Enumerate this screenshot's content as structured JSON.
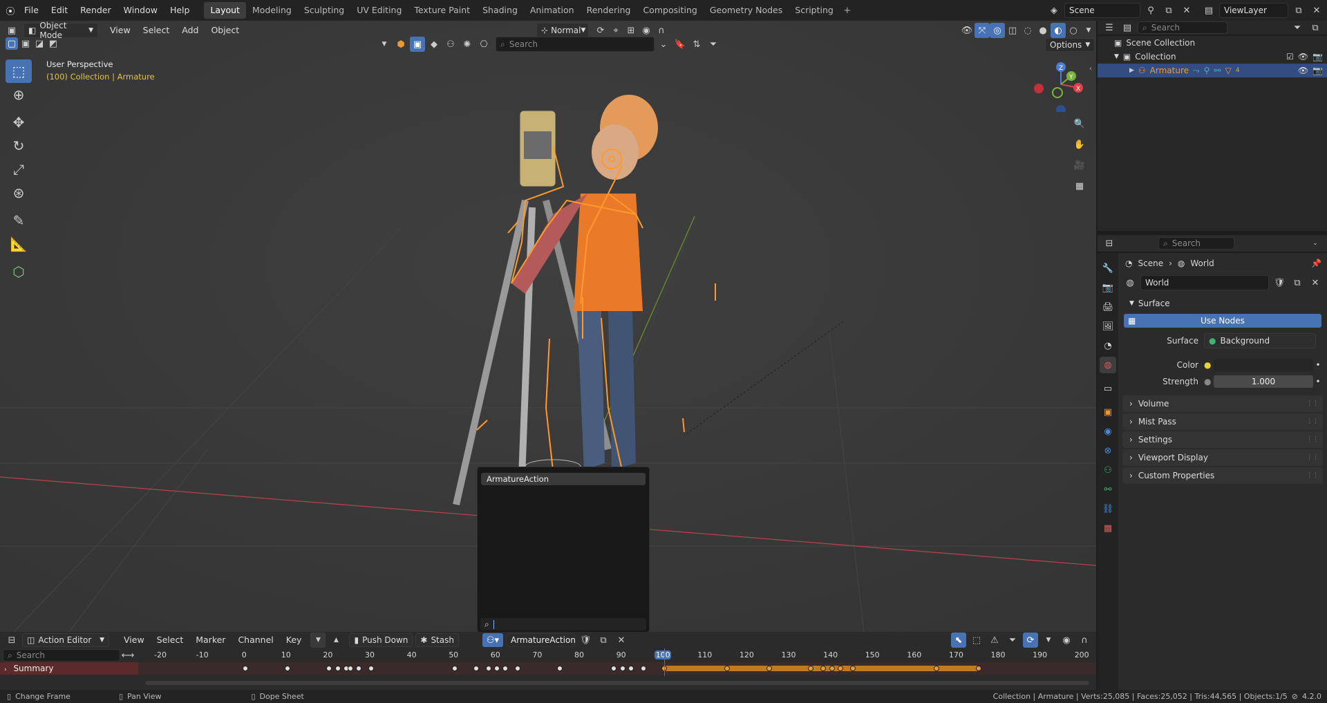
{
  "topbar": {
    "menus": [
      "File",
      "Edit",
      "Render",
      "Window",
      "Help"
    ],
    "workspaces": [
      "Layout",
      "Modeling",
      "Sculpting",
      "UV Editing",
      "Texture Paint",
      "Shading",
      "Animation",
      "Rendering",
      "Compositing",
      "Geometry Nodes",
      "Scripting"
    ],
    "active_workspace": "Layout",
    "scene": "Scene",
    "view_layer": "ViewLayer"
  },
  "viewport": {
    "mode": "Object Mode",
    "menus": [
      "View",
      "Select",
      "Add",
      "Object"
    ],
    "orientation": "Normal",
    "search_placeholder": "Search",
    "options_label": "Options",
    "perspective_label": "User Perspective",
    "collection_label": "(100) Collection | Armature",
    "gizmo_axes": [
      "X",
      "Y",
      "Z"
    ]
  },
  "outliner": {
    "search_placeholder": "Search",
    "items": [
      {
        "label": "Scene Collection"
      },
      {
        "label": "Collection"
      },
      {
        "label": "Armature",
        "extra": "4"
      }
    ]
  },
  "properties": {
    "search_placeholder": "Search",
    "breadcrumb": [
      "Scene",
      "World"
    ],
    "world_name": "World",
    "surface_panel": "Surface",
    "use_nodes_label": "Use Nodes",
    "surface_label": "Surface",
    "surface_value": "Background",
    "color_label": "Color",
    "strength_label": "Strength",
    "strength_value": "1.000",
    "panels": [
      "Volume",
      "Mist Pass",
      "Settings",
      "Viewport Display",
      "Custom Properties"
    ]
  },
  "popup": {
    "items": [
      "ArmatureAction"
    ],
    "search_value": ""
  },
  "timeline": {
    "editor_type": "Action Editor",
    "menus": [
      "View",
      "Select",
      "Marker",
      "Channel",
      "Key"
    ],
    "push_down_label": "Push Down",
    "stash_label": "Stash",
    "action_name": "ArmatureAction",
    "search_placeholder": "Search",
    "summary_label": "Summary",
    "ruler": [
      "-20",
      "-10",
      "0",
      "10",
      "20",
      "30",
      "40",
      "50",
      "60",
      "70",
      "80",
      "90",
      "100",
      "110",
      "120",
      "130",
      "140",
      "150",
      "160",
      "170",
      "180",
      "190",
      "200"
    ],
    "current_frame": "100",
    "keyframes": [
      0,
      10,
      20,
      22,
      24,
      25,
      27,
      30,
      50,
      55,
      58,
      60,
      62,
      65,
      75,
      88,
      90,
      92,
      95,
      100,
      115,
      125,
      135,
      138,
      140,
      142,
      145,
      165,
      175
    ],
    "selected_from": 100
  },
  "statusbar": {
    "left": [
      "Change Frame",
      "Pan View",
      "Dope Sheet"
    ],
    "right": "Collection | Armature | Verts:25,085 | Faces:25,052 | Tris:44,565 | Objects:1/5",
    "version": "4.2.0"
  },
  "colors": {
    "accent": "#4772b3",
    "bone": "#ff9a2a",
    "active_text": "#e0a63a",
    "summary_bg": "#5c2a2a"
  }
}
